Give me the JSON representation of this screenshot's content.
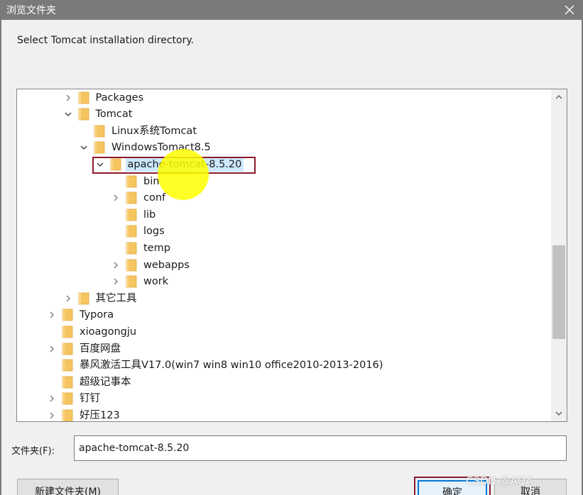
{
  "window": {
    "title": "浏览文件夹"
  },
  "instruction": "Select Tomcat installation directory.",
  "tree": {
    "items": [
      {
        "label": "Packages",
        "depth": 3,
        "expander": "collapsed",
        "selected": false
      },
      {
        "label": "Tomcat",
        "depth": 3,
        "expander": "expanded",
        "selected": false
      },
      {
        "label": "Linux系统Tomcat",
        "depth": 4,
        "expander": "none",
        "selected": false
      },
      {
        "label": "WindowsTomact8.5",
        "depth": 4,
        "expander": "expanded",
        "selected": false
      },
      {
        "label": "apache-tomcat-8.5.20",
        "depth": 5,
        "expander": "expanded",
        "selected": true
      },
      {
        "label": "bin",
        "depth": 6,
        "expander": "none",
        "selected": false
      },
      {
        "label": "conf",
        "depth": 6,
        "expander": "collapsed",
        "selected": false
      },
      {
        "label": "lib",
        "depth": 6,
        "expander": "none",
        "selected": false
      },
      {
        "label": "logs",
        "depth": 6,
        "expander": "none",
        "selected": false
      },
      {
        "label": "temp",
        "depth": 6,
        "expander": "none",
        "selected": false
      },
      {
        "label": "webapps",
        "depth": 6,
        "expander": "collapsed",
        "selected": false
      },
      {
        "label": "work",
        "depth": 6,
        "expander": "collapsed",
        "selected": false
      },
      {
        "label": "其它工具",
        "depth": 3,
        "expander": "collapsed",
        "selected": false
      },
      {
        "label": "Typora",
        "depth": 2,
        "expander": "collapsed",
        "selected": false
      },
      {
        "label": "xioagongju",
        "depth": 2,
        "expander": "none",
        "selected": false
      },
      {
        "label": "百度网盘",
        "depth": 2,
        "expander": "collapsed",
        "selected": false
      },
      {
        "label": "暴风激活工具V17.0(win7 win8 win10 office2010-2013-2016)",
        "depth": 2,
        "expander": "none",
        "selected": false
      },
      {
        "label": "超级记事本",
        "depth": 2,
        "expander": "none",
        "selected": false
      },
      {
        "label": "钉钉",
        "depth": 2,
        "expander": "collapsed",
        "selected": false
      },
      {
        "label": "好压123",
        "depth": 2,
        "expander": "collapsed",
        "selected": false
      }
    ]
  },
  "folder_field": {
    "label": "文件夹(F):",
    "value": "apache-tomcat-8.5.20"
  },
  "buttons": {
    "new_folder": "新建文件夹(M)",
    "ok": "确定",
    "cancel": "取消"
  },
  "watermark": "CSDN @AQA",
  "colors": {
    "titlebar": "#7a7a7a",
    "selection": "#cce8ff",
    "annotation_box": "#8b1a2b",
    "cursor_highlight": "#ffff00",
    "folder": "#f6c560"
  },
  "icons": {
    "folder": "folder-icon",
    "expanded": "chevron-down-icon",
    "collapsed": "chevron-right-icon",
    "close": "close-icon"
  }
}
